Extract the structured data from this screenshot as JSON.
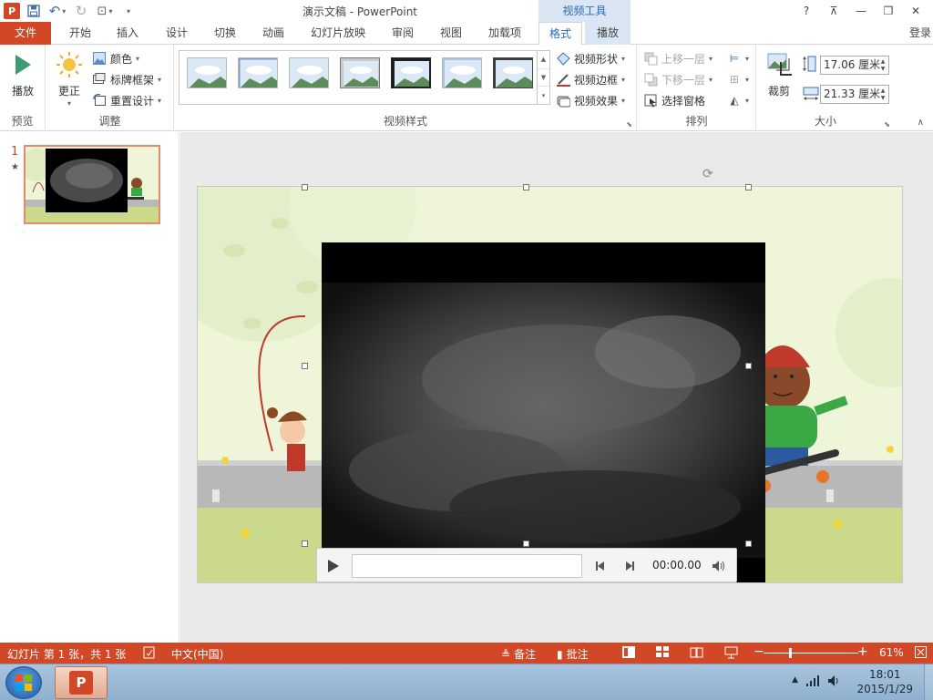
{
  "window": {
    "title": "演示文稿 - PowerPoint",
    "contextual_tab_header": "视频工具",
    "controls": {
      "help": "?",
      "ribbon_options": "⊼",
      "minimize": "—",
      "restore": "❐",
      "close": "✕"
    }
  },
  "tabs": {
    "file": "文件",
    "home": "开始",
    "insert": "插入",
    "design": "设计",
    "transitions": "切换",
    "animations": "动画",
    "slideshow": "幻灯片放映",
    "review": "审阅",
    "view": "视图",
    "addins": "加载项",
    "format": "格式",
    "playback": "播放",
    "login": "登录"
  },
  "ribbon": {
    "preview": {
      "label": "预览",
      "play": "播放"
    },
    "adjust": {
      "label": "调整",
      "corrections": "更正",
      "color": "颜色",
      "poster_frame": "标牌框架",
      "reset_design": "重置设计"
    },
    "video_styles": {
      "label": "视频样式",
      "shape": "视频形状",
      "border": "视频边框",
      "effects": "视频效果"
    },
    "arrange": {
      "label": "排列",
      "bring_forward": "上移一层",
      "send_backward": "下移一层",
      "selection_pane": "选择窗格"
    },
    "size": {
      "label": "大小",
      "crop": "裁剪",
      "height": "17.06 厘米",
      "width": "21.33 厘米"
    }
  },
  "slide_panel": {
    "number": "1",
    "star": "★"
  },
  "video_controls": {
    "time": "00:00.00"
  },
  "status": {
    "slide_info": "幻灯片 第 1 张，共 1 张",
    "language": "中文(中国)",
    "notes": "备注",
    "comments": "批注",
    "zoom": "61%"
  },
  "taskbar": {
    "time": "18:01",
    "date": "2015/1/29"
  },
  "colors": {
    "accent": "#d24726",
    "contextual": "#dbe6f4",
    "contextual_text": "#2a6bb0"
  }
}
